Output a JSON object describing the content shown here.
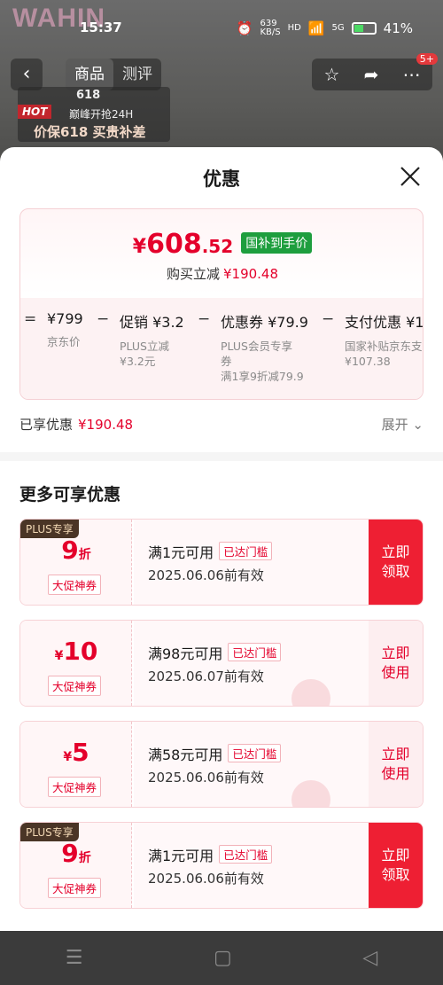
{
  "status_bar": {
    "time": "15:37",
    "net_speed_value": "639",
    "net_speed_unit": "KB/S",
    "hd": "HD",
    "signal": "5G",
    "battery": "41%"
  },
  "background": {
    "logo": "WAHIN",
    "nav_tabs": [
      "商品",
      "测评"
    ],
    "badge": "5+",
    "promo": {
      "tag": "HOT",
      "event": "618",
      "line1": "巅峰开抢24H",
      "line2": "价保618 买贵补差"
    }
  },
  "sheet": {
    "title": "优惠",
    "final_price": {
      "currency": "¥",
      "integer": "608",
      "decimal": ".52",
      "tag": "国补到手价"
    },
    "subtext": {
      "label": "购买立减",
      "amount": "¥190.48"
    },
    "breakdown": [
      {
        "op": "=",
        "label": "¥799",
        "desc": [
          "京东价"
        ]
      },
      {
        "op": "−",
        "label": "促销 ¥3.2",
        "desc": [
          "PLUS立减",
          "¥3.2元"
        ]
      },
      {
        "op": "−",
        "label": "优惠券 ¥79.9",
        "desc": [
          "PLUS会员专享",
          "券",
          "满1享9折减79.9"
        ]
      },
      {
        "op": "−",
        "label": "支付优惠 ¥1",
        "desc": [
          "国家补贴京东支",
          "¥107.38"
        ]
      }
    ],
    "enjoyed": {
      "label": "已享优惠",
      "amount": "¥190.48"
    },
    "expand_label": "展开",
    "more_title": "更多可享优惠",
    "coupons": [
      {
        "plus_label": "PLUS专享",
        "amount_big": "9",
        "amount_sm": "折",
        "amount_prefix": "",
        "type_label": "大促神券",
        "condition": "满1元可用",
        "met_label": "已达门槛",
        "valid": "2025.06.06前有效",
        "action": [
          "立即",
          "领取"
        ],
        "style": "solid"
      },
      {
        "plus_label": "",
        "amount_big": "10",
        "amount_sm": "",
        "amount_prefix": "¥",
        "type_label": "大促神券",
        "condition": "满98元可用",
        "met_label": "已达门槛",
        "valid": "2025.06.07前有效",
        "action": [
          "立即",
          "使用"
        ],
        "style": "ghost"
      },
      {
        "plus_label": "",
        "amount_big": "5",
        "amount_sm": "",
        "amount_prefix": "¥",
        "type_label": "大促神券",
        "condition": "满58元可用",
        "met_label": "已达门槛",
        "valid": "2025.06.06前有效",
        "action": [
          "立即",
          "使用"
        ],
        "style": "ghost"
      },
      {
        "plus_label": "PLUS专享",
        "amount_big": "9",
        "amount_sm": "折",
        "amount_prefix": "",
        "type_label": "大促神券",
        "condition": "满1元可用",
        "met_label": "已达门槛",
        "valid": "2025.06.06前有效",
        "action": [
          "立即",
          "领取"
        ],
        "style": "solid"
      }
    ]
  },
  "colors": {
    "accent": "#e4002b",
    "tag_green": "#1e9e3e",
    "plus_brown": "#4a3526"
  }
}
